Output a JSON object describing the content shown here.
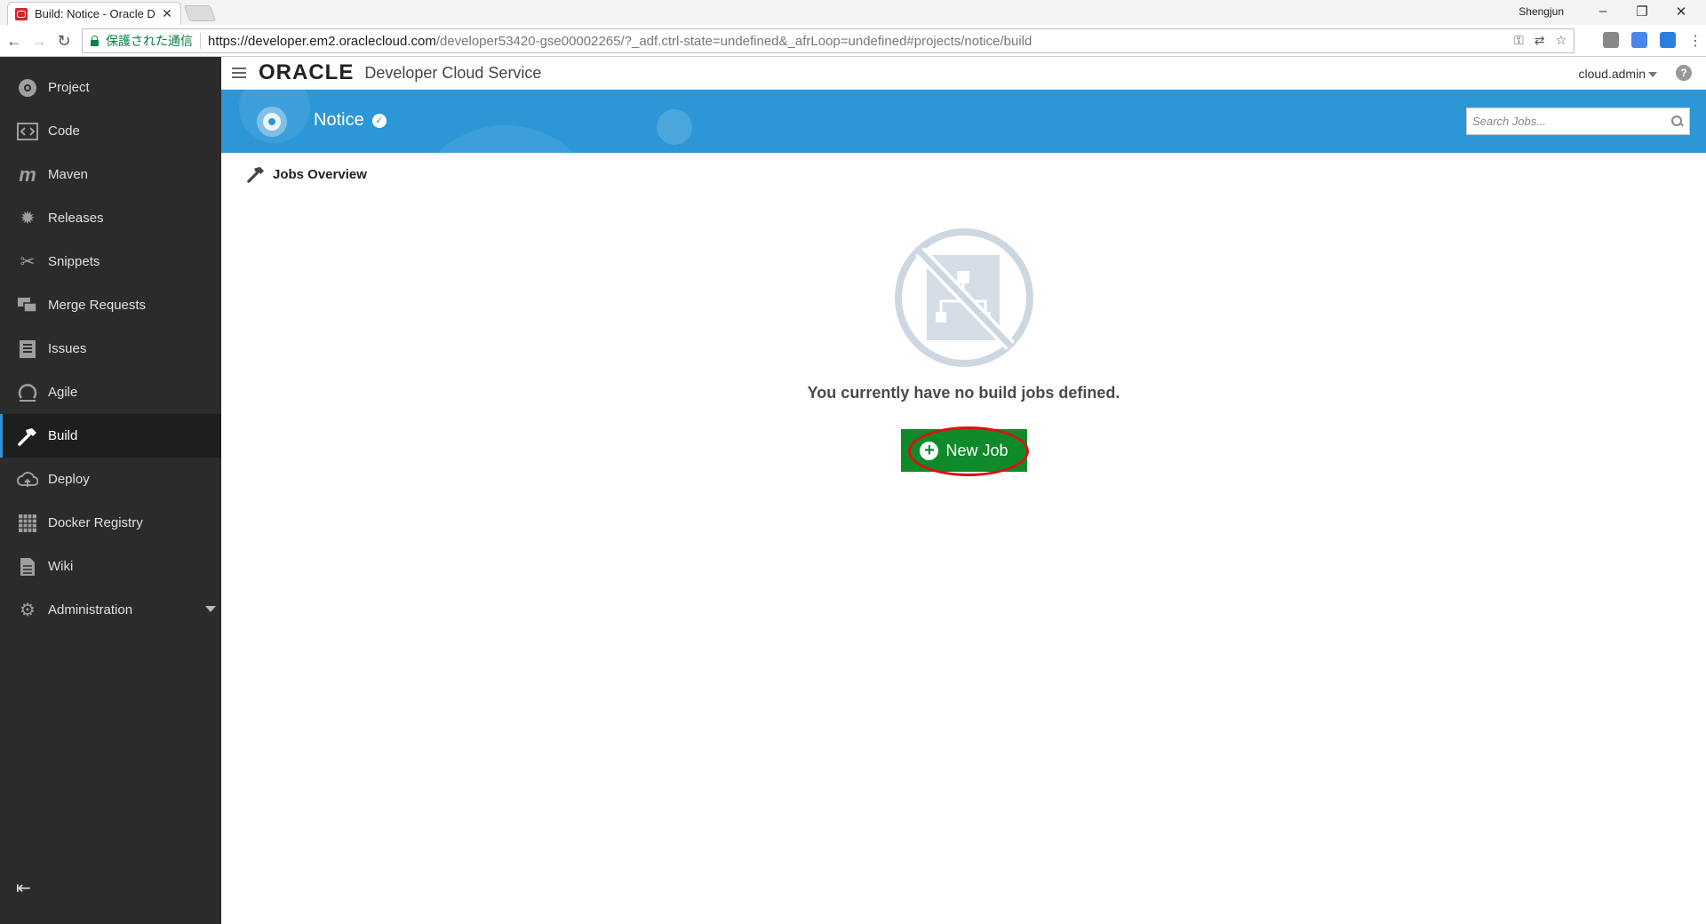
{
  "browser": {
    "tab_title": "Build: Notice - Oracle D",
    "user_label": "Shengjun",
    "secure_text": "保護された通信",
    "url_host": "https://developer.em2.oraclecloud.com",
    "url_path": "/developer53420-gse00002265/?_adf.ctrl-state=undefined&_afrLoop=undefined#projects/notice/build"
  },
  "header": {
    "logo": "ORACLE",
    "product": "Developer Cloud Service",
    "account": "cloud.admin",
    "help": "?"
  },
  "sidebar": {
    "items": [
      {
        "label": "Project",
        "icon": "project-icon"
      },
      {
        "label": "Code",
        "icon": "code-icon"
      },
      {
        "label": "Maven",
        "icon": "maven-icon"
      },
      {
        "label": "Releases",
        "icon": "releases-icon"
      },
      {
        "label": "Snippets",
        "icon": "snippets-icon"
      },
      {
        "label": "Merge Requests",
        "icon": "merge-requests-icon"
      },
      {
        "label": "Issues",
        "icon": "issues-icon"
      },
      {
        "label": "Agile",
        "icon": "agile-icon"
      },
      {
        "label": "Build",
        "icon": "hammer-icon",
        "active": true
      },
      {
        "label": "Deploy",
        "icon": "deploy-icon"
      },
      {
        "label": "Docker Registry",
        "icon": "docker-icon"
      },
      {
        "label": "Wiki",
        "icon": "wiki-icon"
      },
      {
        "label": "Administration",
        "icon": "gear-icon"
      }
    ]
  },
  "banner": {
    "project_name": "Notice",
    "search_placeholder": "Search Jobs..."
  },
  "main": {
    "section_title": "Jobs Overview",
    "empty_message": "You currently have no build jobs defined.",
    "new_job_label": "New Job"
  },
  "colors": {
    "sidebar_bg": "#2b2b2b",
    "banner_bg": "#2c97d6",
    "new_job_green": "#0e8a2b",
    "highlight_red": "#dd1111"
  }
}
